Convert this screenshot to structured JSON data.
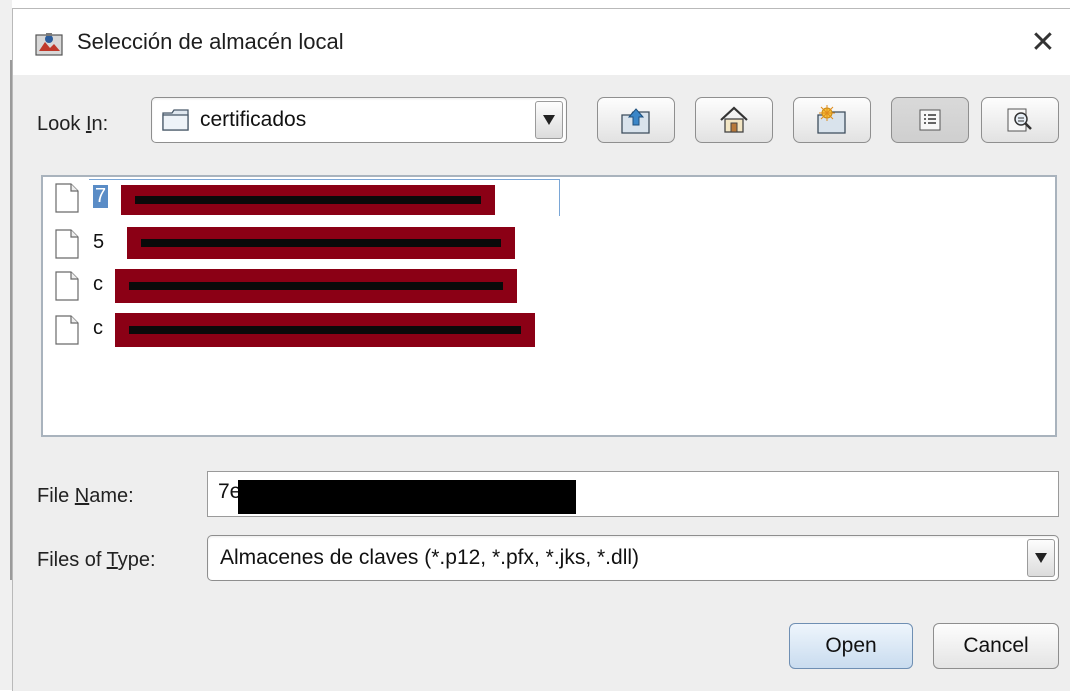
{
  "window": {
    "title": "Selección de almacén local",
    "close_glyph": "✕"
  },
  "look_in": {
    "label_pre": "Look ",
    "label_mnemonic": "I",
    "label_post": "n:",
    "value": "certificados"
  },
  "toolbar": {
    "icons": [
      "up-folder-icon",
      "home-icon",
      "new-folder-icon",
      "list-view-icon",
      "details-view-icon"
    ]
  },
  "files": [
    {
      "name_visible": "7",
      "selected": true
    },
    {
      "name_visible": "5",
      "selected": false
    },
    {
      "name_visible": "c",
      "selected": false
    },
    {
      "name_visible": "c",
      "selected": false
    }
  ],
  "file_name": {
    "label_pre": "File ",
    "label_mnemonic": "N",
    "label_post": "ame:",
    "value": "7e"
  },
  "files_of_type": {
    "label_pre": "Files of ",
    "label_mnemonic": "T",
    "label_post": "ype:",
    "value": "Almacenes de claves (*.p12, *.pfx, *.jks, *.dll)"
  },
  "buttons": {
    "open": "Open",
    "cancel": "Cancel"
  },
  "colors": {
    "selection": "#5a8cc6",
    "redaction_red": "#8b0015",
    "redaction_black": "#000000"
  }
}
